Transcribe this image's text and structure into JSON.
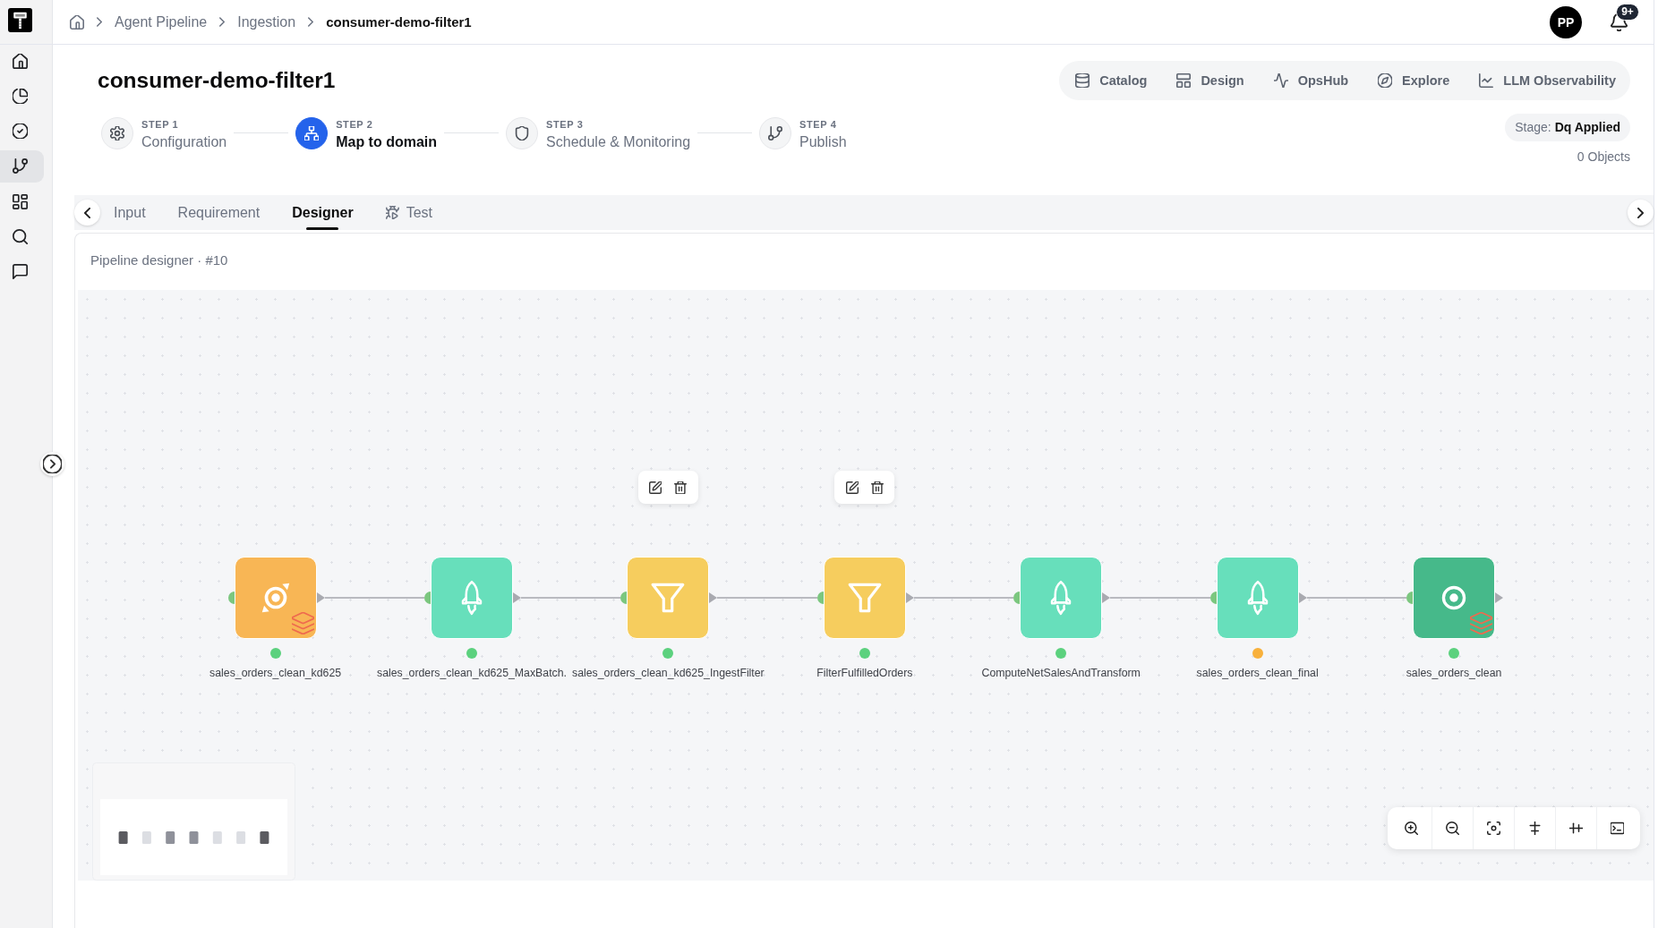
{
  "sidebar": {
    "items": [
      {
        "selected": false
      },
      {
        "selected": false
      },
      {
        "selected": false
      },
      {
        "selected": true
      },
      {
        "selected": false
      },
      {
        "selected": false
      },
      {
        "selected": false
      }
    ]
  },
  "breadcrumb": [
    {
      "label": "Agent Pipeline",
      "current": false
    },
    {
      "label": "Ingestion",
      "current": false
    },
    {
      "label": "consumer-demo-filter1",
      "current": true
    }
  ],
  "user": {
    "initials": "PP"
  },
  "notifications": {
    "count": "9+"
  },
  "page": {
    "title": "consumer-demo-filter1",
    "stage": "Stage: **Dq Applied**",
    "objects": "0 Objects"
  },
  "nav_links": [
    {
      "label": "Catalog"
    },
    {
      "label": "Design"
    },
    {
      "label": "OpsHub"
    },
    {
      "label": "Explore"
    },
    {
      "label": "LLM Observability"
    }
  ],
  "steps": [
    {
      "step": "STEP 1",
      "title": "Configuration",
      "selected": false
    },
    {
      "step": "STEP 2",
      "title": "Map to domain",
      "selected": true
    },
    {
      "step": "STEP 3",
      "title": "Schedule & Monitoring",
      "selected": false
    },
    {
      "step": "STEP 4",
      "title": "Publish",
      "selected": false
    }
  ],
  "tabs": [
    {
      "label": "Input",
      "selected": false
    },
    {
      "label": "Requirement",
      "selected": false
    },
    {
      "label": "Designer",
      "selected": true
    },
    {
      "label": "Test",
      "selected": false
    }
  ],
  "designer": {
    "title": "Pipeline designer · #10",
    "nodes": [
      {
        "kind": "source",
        "label": "sales_orders_clean_kd625",
        "color": "#5cd17e",
        "toolbar": false
      },
      {
        "kind": "transform",
        "label": "sales_orders_clean_kd625_MaxBatch.",
        "color": "#5cd17e",
        "toolbar": false
      },
      {
        "kind": "filter",
        "label": "sales_orders_clean_kd625_IngestFilter",
        "color": "#5cd17e",
        "toolbar": true
      },
      {
        "kind": "filter",
        "label": "FilterFulfilledOrders",
        "color": "#5cd17e",
        "toolbar": true
      },
      {
        "kind": "transform",
        "label": "ComputeNetSalesAndTransform",
        "color": "#5cd17e",
        "toolbar": false
      },
      {
        "kind": "transform",
        "label": "sales_orders_clean_final",
        "color": "#f8b13c",
        "toolbar": false
      },
      {
        "kind": "sink",
        "label": "sales_orders_clean",
        "color": "#5cd17e",
        "toolbar": false
      }
    ]
  }
}
